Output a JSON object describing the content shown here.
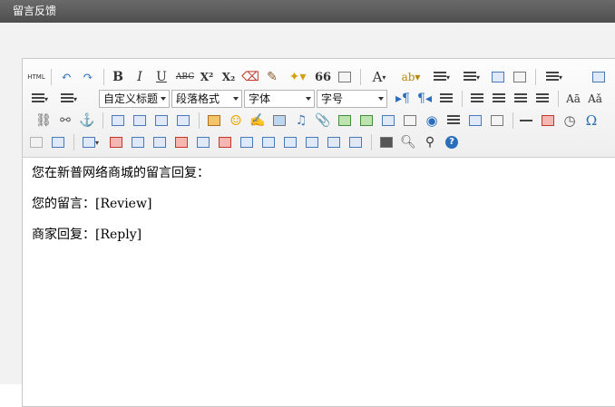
{
  "window": {
    "title": "留言反馈"
  },
  "toolbar": {
    "html_label": "HTML",
    "bold": "B",
    "italic": "I",
    "underline": "U",
    "strike": "ABC",
    "superscript": "X²",
    "subscript": "X₂",
    "quote": "66",
    "font_color": "A",
    "custom_heading": "自定义标题",
    "paragraph_format": "段落格式",
    "font_family": "字体",
    "font_size": "字号",
    "omega": "Ω",
    "help": "?"
  },
  "content": {
    "line1": "您在新普网络商城的留言回复：",
    "line2_label": "您的留言：",
    "line2_value": "[Review]",
    "line3_label": "商家回复：",
    "line3_value": "[Reply]"
  }
}
